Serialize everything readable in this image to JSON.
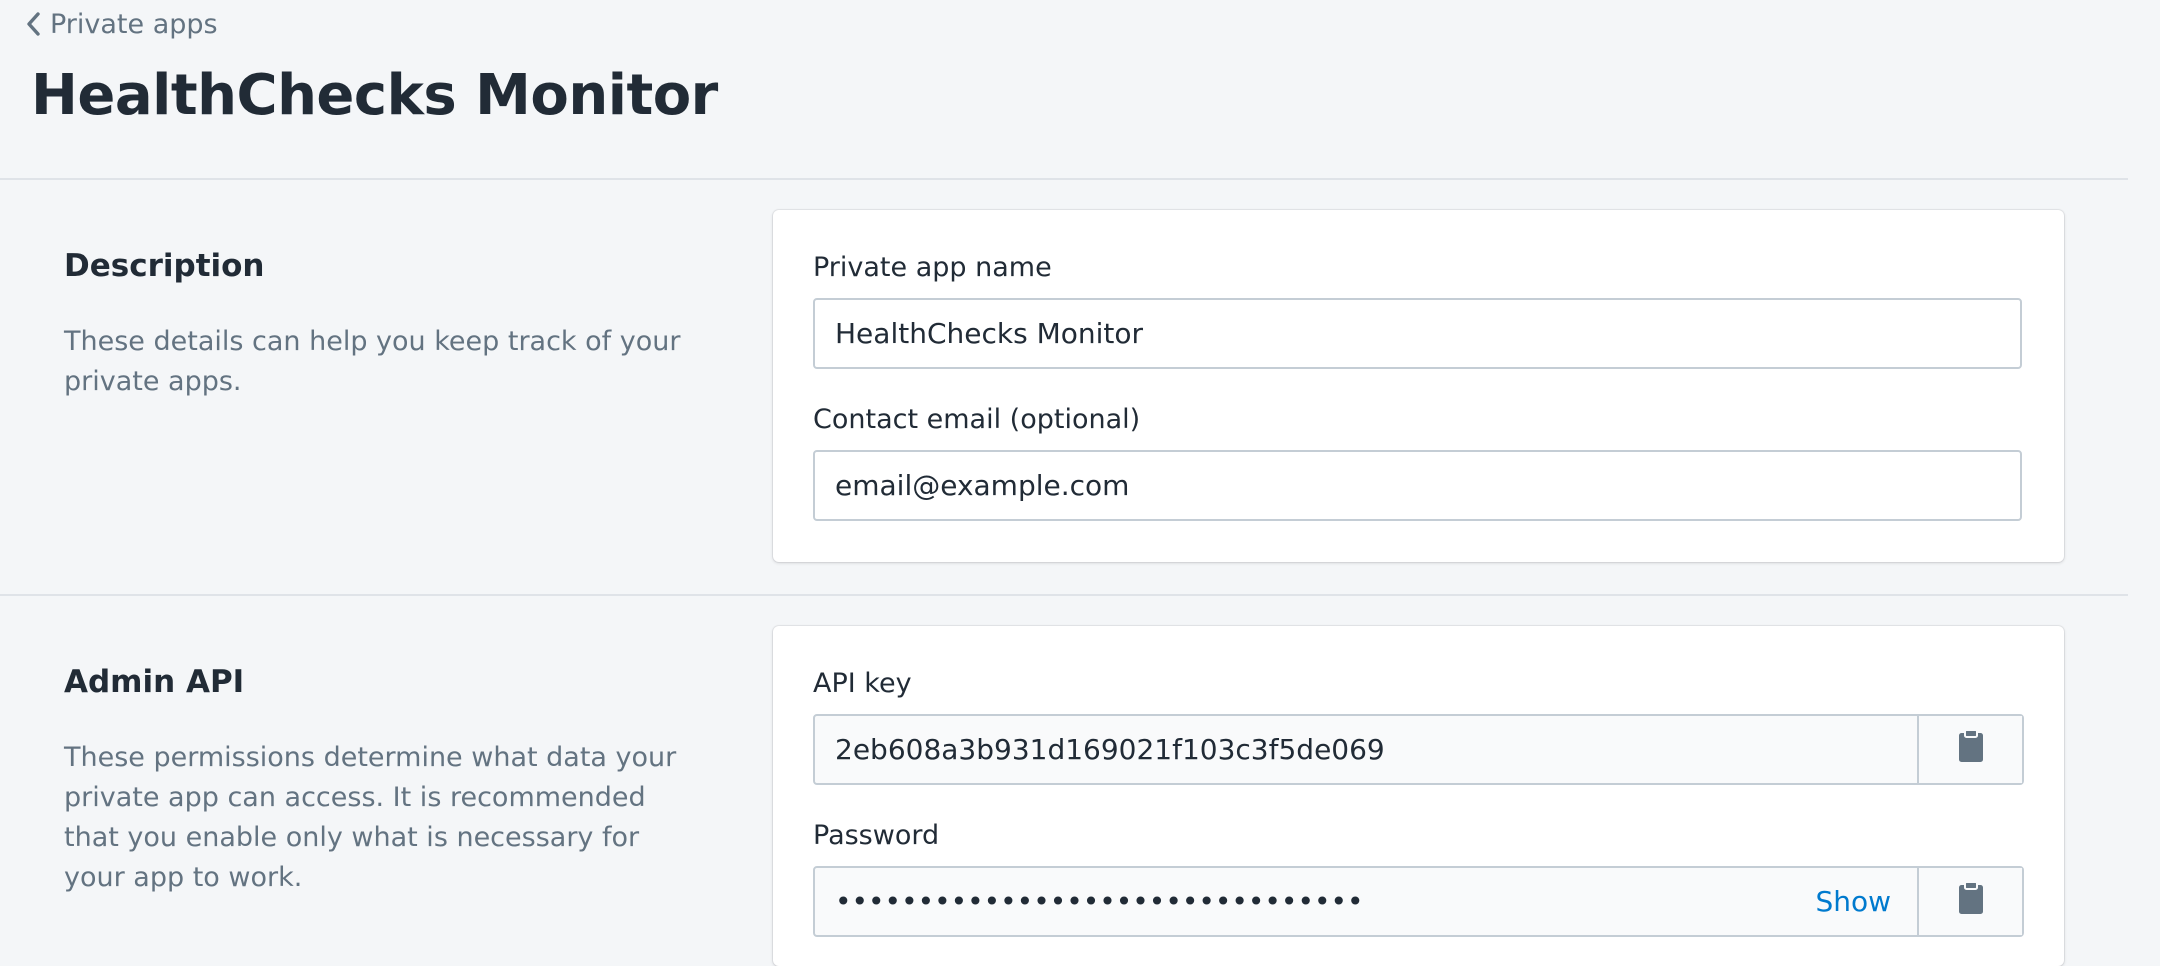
{
  "breadcrumb": {
    "label": "Private apps"
  },
  "page": {
    "title": "HealthChecks Monitor"
  },
  "description_section": {
    "heading": "Description",
    "text": "These details can help you keep track of your private apps.",
    "fields": {
      "app_name_label": "Private app name",
      "app_name_value": "HealthChecks Monitor",
      "email_label": "Contact email (optional)",
      "email_value": "email@example.com"
    }
  },
  "admin_api_section": {
    "heading": "Admin API",
    "text": "These permissions determine what data your private app can access. It is recommended that you enable only what is necessary for your app to work.",
    "fields": {
      "api_key_label": "API key",
      "api_key_value": "2eb608a3b931d169021f103c3f5de069",
      "password_label": "Password",
      "password_mask": "••••••••••••••••••••••••••••••••",
      "show_label": "Show"
    }
  },
  "icons": {
    "back": "chevron-left-icon",
    "copy": "clipboard-icon"
  },
  "colors": {
    "background": "#f4f6f8",
    "link": "#007ace",
    "muted_text": "#637381",
    "icon": "#637381"
  }
}
